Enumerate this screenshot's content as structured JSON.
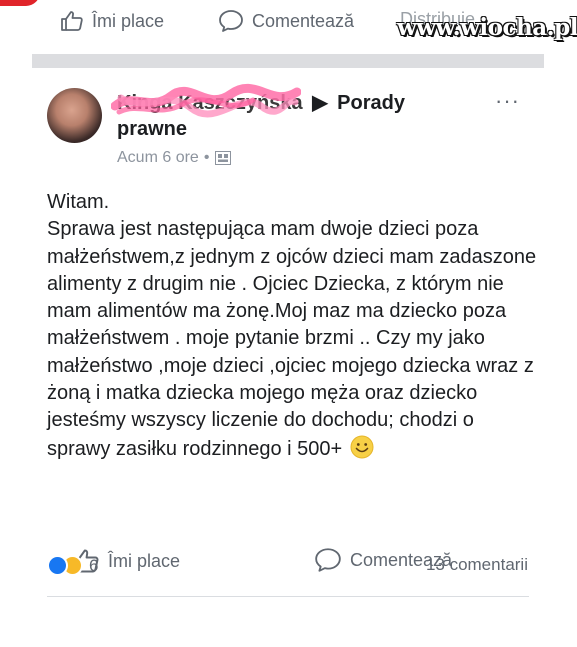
{
  "top_bar": {
    "like_label": "Îmi place",
    "comment_label": "Comentează",
    "share_label": "Distribuie",
    "watermark": "www.wiocha.pl"
  },
  "post": {
    "author_name": "Kinga Kaszczyńska",
    "group_name": "Porady prawne",
    "timestamp": "Acum 6 ore",
    "body": "Witam.\nSprawa jest następująca mam dwoje dzieci poza małżeństwem,z jednym z ojców dzieci mam zadaszone alimenty z drugim nie . Ojciec Dziecka, z którym nie mam alimentów ma żonę.Moj maz ma dziecko poza małżeństwem  . moje pytanie brzmi .. Czy my jako małżeństwo ,moje dzieci ,ojciec mojego dziecka wraz z żoną i matka dziecka mojego męża oraz dziecko jesteśmy wszyscy liczenie do dochodu; chodzi o sprawy zasiłku rodzinnego i 500+",
    "reactions_count": "6",
    "comments_count": "13 comentarii"
  },
  "actions": {
    "like_label": "Îmi place",
    "comment_label": "Comentează"
  },
  "colors": {
    "facebook_blue": "#1877f2",
    "haha_yellow": "#f7b928",
    "scribble_pink": "#ff6fa8",
    "muted_text": "#606770"
  }
}
